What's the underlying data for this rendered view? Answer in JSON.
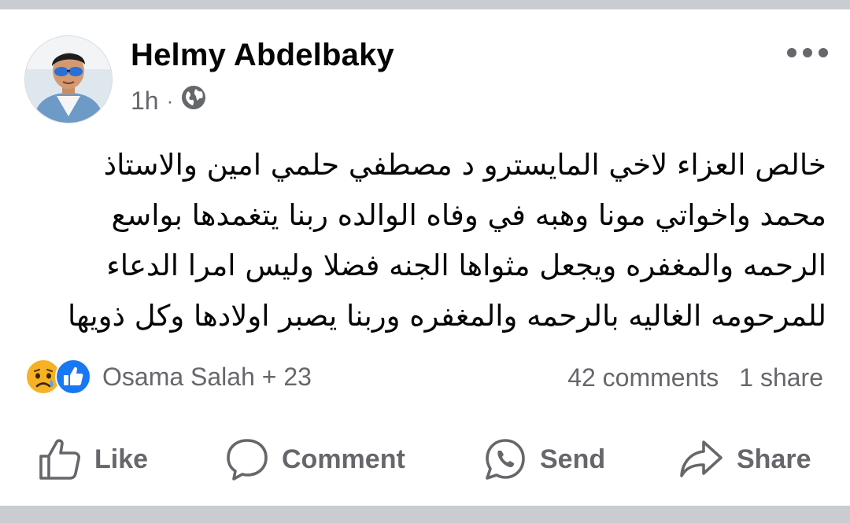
{
  "post": {
    "author": "Helmy Abdelbaky",
    "time": "1h",
    "separator": "·",
    "privacy_icon": "globe-icon",
    "more_icon": "more-horizontal-icon",
    "text_lines": [
      "خالص العزاء لاخي المايسترو د مصطفي حلمي امين والاستاذ",
      "محمد واخواتي مونا وهبه في وفاه الوالده ربنا يتغمدها بواسع",
      "الرحمه والمغفره ويجعل مثواها الجنه فضلا وليس امرا الدعاء",
      "للمرحومه الغاليه  بالرحمه والمغفره وربنا يصبر اولادها وكل ذويها"
    ]
  },
  "reactions": {
    "icons": [
      "sad-reaction-icon",
      "like-reaction-icon"
    ],
    "names": "Osama Salah + 23"
  },
  "counts": {
    "comments": "42 comments",
    "shares": "1 share"
  },
  "actions": [
    {
      "label": "Like",
      "icon": "thumbs-up-icon"
    },
    {
      "label": "Comment",
      "icon": "comment-bubble-icon"
    },
    {
      "label": "Send",
      "icon": "whatsapp-icon"
    },
    {
      "label": "Share",
      "icon": "share-arrow-icon"
    }
  ],
  "colors": {
    "text": "#050505",
    "secondary": "#65676b",
    "divider": "#c9ccd1",
    "like_blue": "#1877f2",
    "sad_yellow": "#f7b125"
  }
}
